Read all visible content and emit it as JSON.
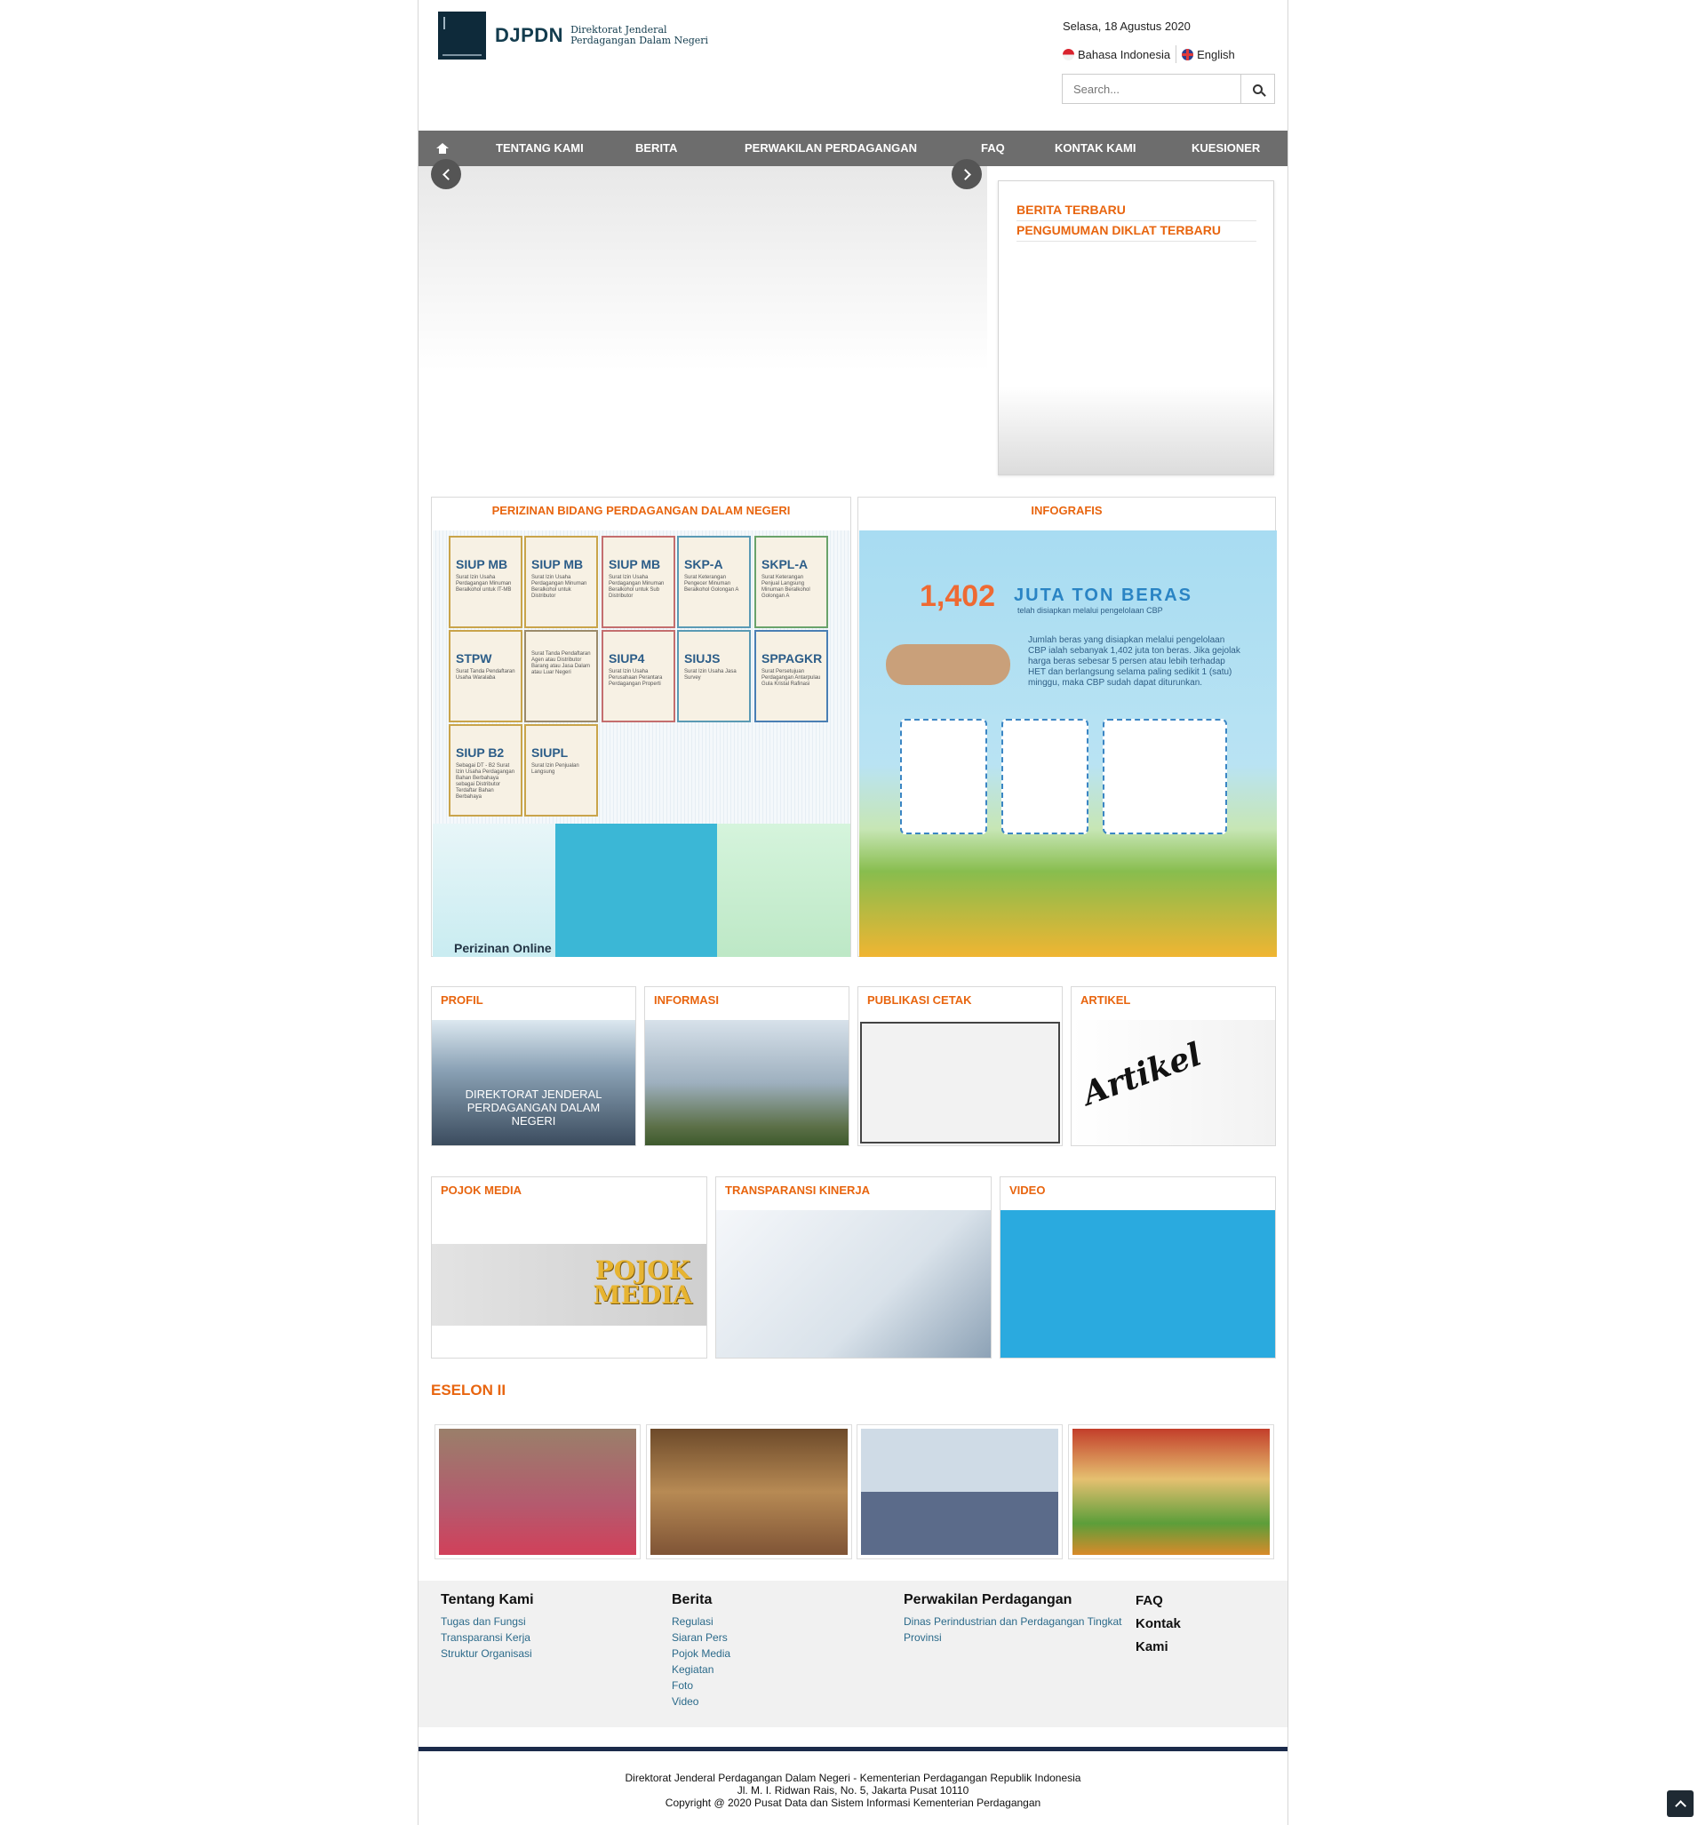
{
  "header": {
    "logo_abbr": "DJPDN",
    "logo_line1": "Direktorat Jenderal",
    "logo_line2": "Perdagangan Dalam Negeri",
    "date": "Selasa, 18 Agustus 2020",
    "lang_id": "Bahasa Indonesia",
    "lang_en": "English",
    "search_placeholder": "Search..."
  },
  "nav": {
    "items": [
      "TENTANG KAMI",
      "BERITA",
      "PERWAKILAN PERDAGANGAN",
      "FAQ",
      "KONTAK KAMI",
      "KUESIONER"
    ]
  },
  "news": {
    "tab1": "BERITA TERBARU",
    "tab2": "PENGUMUMAN DIKLAT TERBARU"
  },
  "panels": {
    "perizinan": "PERIZINAN BIDANG PERDAGANGAN DALAM NEGERI",
    "infografis": "INFOGRAFIS",
    "profil": "PROFIL",
    "informasi": "INFORMASI",
    "publikasi": "PUBLIKASI CETAK",
    "artikel": "ARTIKEL",
    "pojok": "POJOK MEDIA",
    "transparansi": "TRANSPARANSI KINERJA",
    "video": "VIDEO"
  },
  "permits": [
    {
      "code": "SIUP MB",
      "desc": "Surat Izin Usaha Perdagangan Minuman Beralkohol untuk IT-MB"
    },
    {
      "code": "SIUP MB",
      "desc": "Surat Izin Usaha Perdagangan Minuman Beralkohol untuk Distributor"
    },
    {
      "code": "SIUP MB",
      "desc": "Surat Izin Usaha Perdagangan Minuman Beralkohol untuk Sub Distributor"
    },
    {
      "code": "SKP-A",
      "desc": "Surat Keterangan Pengecer Minuman Beralkohol Golongan A"
    },
    {
      "code": "SKPL-A",
      "desc": "Surat Keterangan Penjual Langsung Minuman Beralkohol Golongan A"
    },
    {
      "code": "STPW",
      "desc": "Surat Tanda Pendaftaran Usaha Waralaba"
    },
    {
      "code": "",
      "desc": "Surat Tanda Pendaftaran Agen atau Distributor Barang atau Jasa Dalam atau Luar Negeri"
    },
    {
      "code": "SIUP4",
      "desc": "Surat Izin Usaha Perusahaan Perantara Perdagangan Properti"
    },
    {
      "code": "SIUJS",
      "desc": "Surat Izin Usaha Jasa Survey"
    },
    {
      "code": "SPPAGKR",
      "desc": "Surat Persetujuan Perdagangan Antarpulau Gula Kristal Rafinasi"
    },
    {
      "code": "SIUP B2",
      "desc": "Sebagai DT - B2 Surat Izin Usaha Perdagangan Bahan Berbahaya sebagai Distributor Terdaftar Bahan Berbahaya"
    },
    {
      "code": "SIUPL",
      "desc": "Surat Izin Penjualan Langsung"
    }
  ],
  "perizinan_online": "Perizinan Online",
  "infografis": {
    "value": "1,402",
    "unit": "JUTA TON BERAS",
    "subtitle": "telah disiapkan melalui pengelolaan CBP",
    "text": "Jumlah beras yang disiapkan melalui pengelolaan CBP ialah sebanyak 1,402 juta ton beras. Jika gejolak harga beras sebesar 5 persen atau lebih terhadap HET dan berlangsung selama paling sedikit 1 (satu) minggu, maka CBP sudah dapat diturunkan."
  },
  "profil_caption": "DIREKTORAT JENDERAL PERDAGANGAN DALAM NEGERI",
  "artikel_word": "Artikel",
  "pojok_word1": "POJOK",
  "pojok_word2": "MEDIA",
  "eselon_title": "ESELON II",
  "footer": {
    "col1_title": "Tentang Kami",
    "col1_links": [
      "Tugas dan Fungsi",
      "Transparansi Kerja",
      "Struktur Organisasi"
    ],
    "col2_title": "Berita",
    "col2_links": [
      "Regulasi",
      "Siaran Pers",
      "Pojok Media",
      "Kegiatan",
      "Foto",
      "Video"
    ],
    "col3_title": "Perwakilan Perdagangan",
    "col3_links": [
      "Dinas Perindustrian dan Perdagangan Tingkat Provinsi"
    ],
    "col4_faq": "FAQ",
    "col4_kontak": "Kontak",
    "col4_kami": "Kami"
  },
  "bottom": {
    "line1": "Direktorat Jenderal Perdagangan Dalam Negeri - Kementerian Perdagangan Republik Indonesia",
    "line2": "Jl. M. I. Ridwan Rais, No. 5, Jakarta Pusat 10110",
    "line3": "Copyright @ 2020 Pusat Data dan Sistem Informasi Kementerian Perdagangan"
  },
  "colors": {
    "accent": "#e8650f",
    "nav_bg": "#6d6d6d",
    "footer_bar": "#1b2a4a"
  }
}
